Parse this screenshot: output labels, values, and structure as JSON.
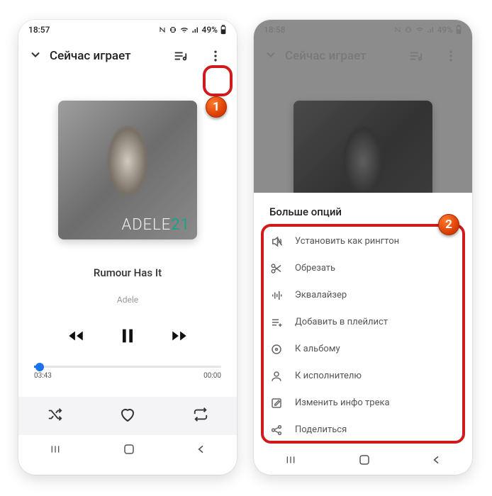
{
  "status": {
    "time_left": "18:57",
    "time_right": "18:58",
    "battery": "49%"
  },
  "header": {
    "title": "Сейчас играет"
  },
  "album": {
    "brand": "ADELE",
    "num": "21"
  },
  "track": {
    "title": "Rumour Has It",
    "artist": "Adele"
  },
  "progress": {
    "elapsed": "03:43",
    "total": "00:00"
  },
  "sheet": {
    "title": "Больше опций",
    "items": [
      {
        "icon": "volume-off-icon",
        "label": "Установить как рингтон"
      },
      {
        "icon": "scissors-icon",
        "label": "Обрезать"
      },
      {
        "icon": "equalizer-icon",
        "label": "Эквалайзер"
      },
      {
        "icon": "playlist-add-icon",
        "label": "Добавить в плейлист"
      },
      {
        "icon": "disc-icon",
        "label": "К альбому"
      },
      {
        "icon": "person-icon",
        "label": "К исполнителю"
      },
      {
        "icon": "edit-icon",
        "label": "Изменить инфо трека"
      },
      {
        "icon": "share-icon",
        "label": "Поделиться"
      }
    ]
  },
  "badges": {
    "one": "1",
    "two": "2"
  }
}
